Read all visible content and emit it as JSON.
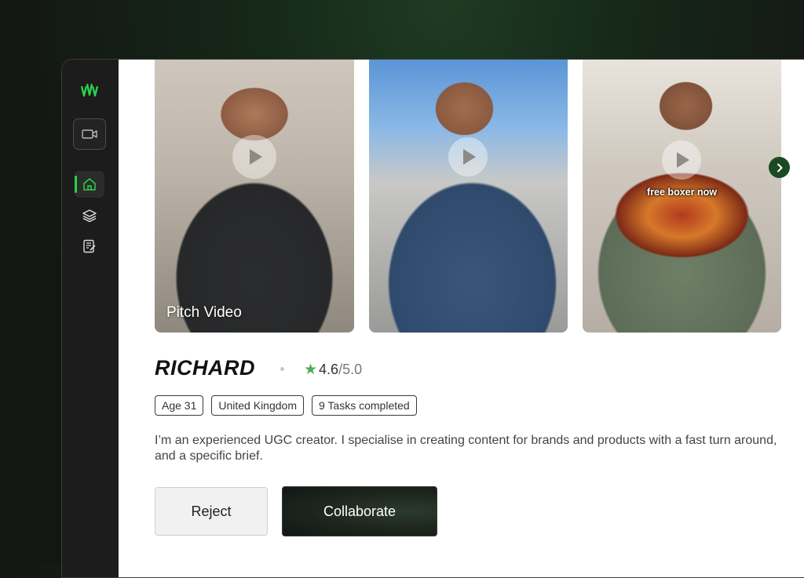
{
  "sidebar": {
    "logo_icon": "brand-logo-icon",
    "video_icon": "video-camera-icon",
    "items": [
      {
        "icon": "home-icon",
        "active": true
      },
      {
        "icon": "layers-icon",
        "active": false
      },
      {
        "icon": "document-edit-icon",
        "active": false
      }
    ],
    "accent_color": "#2bd04d"
  },
  "videos": [
    {
      "label": "Pitch Video",
      "caption": ""
    },
    {
      "label": "",
      "caption": ""
    },
    {
      "label": "",
      "caption": "free boxer now"
    }
  ],
  "profile": {
    "name": "RICHARD",
    "rating": "4.6",
    "rating_max": "/5.0",
    "tags": [
      "Age 31",
      "United Kingdom",
      "9 Tasks completed"
    ],
    "bio": "I’m an experienced UGC creator. I specialise in creating content for brands and products with a fast turn around, and a specific brief."
  },
  "actions": {
    "reject_label": "Reject",
    "collaborate_label": "Collaborate"
  }
}
